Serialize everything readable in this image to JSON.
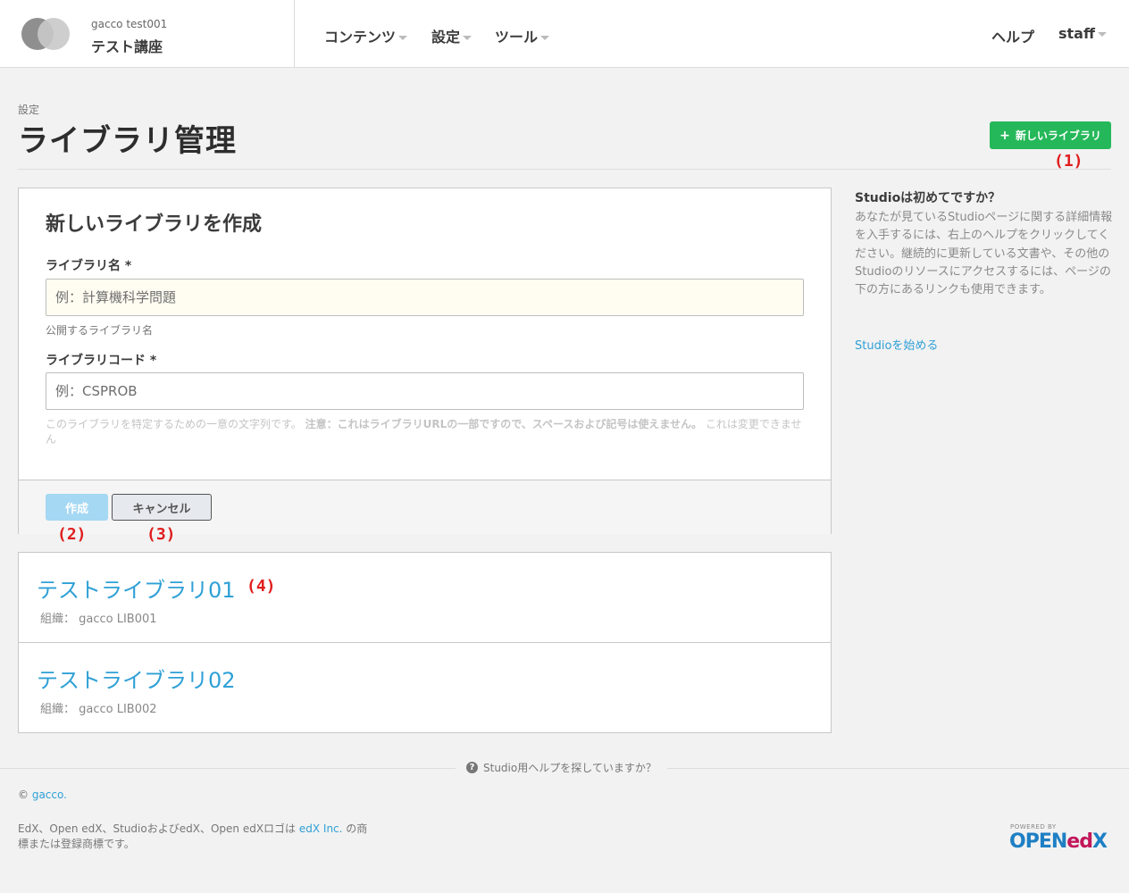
{
  "header": {
    "course_org": "gacco  test001",
    "course_title": "テスト講座",
    "nav": {
      "content": "コンテンツ",
      "settings": "設定",
      "tools": "ツール",
      "help": "ヘルプ",
      "user": "staff"
    }
  },
  "page": {
    "subtitle": "設定",
    "title": "ライブラリ管理",
    "new_library_button": "新しいライブラリ"
  },
  "annotations": {
    "a1": "(1)",
    "a2": "(2)",
    "a3": "(3)",
    "a4": "(4)"
  },
  "form": {
    "heading": "新しいライブラリを作成",
    "name_label": "ライブラリ名 *",
    "name_placeholder": "例：計算機科学問題",
    "name_help": "公開するライブラリ名",
    "code_label": "ライブラリコード *",
    "code_placeholder": "例：CSPROB",
    "code_help_pre": "このライブラリを特定するための一意の文字列です。",
    "code_help_note": "注意：これはライブラリURLの一部ですので、スペースおよび記号は使えません。",
    "code_help_post": "これは変更できません",
    "create_button": "作成",
    "cancel_button": "キャンセル"
  },
  "libraries": [
    {
      "name": "テストライブラリ01",
      "meta": "組織： gacco LIB001"
    },
    {
      "name": "テストライブラリ02",
      "meta": "組織： gacco LIB002"
    }
  ],
  "sidebar": {
    "title": "Studioは初めてですか？",
    "text": "あなたが見ているStudioページに関する詳細情報を入手するには、右上のヘルプをクリックしてください。継続的に更新している文書や、その他のStudioのリソースにアクセスするには、ページの下の方にあるリンクも使用できます。",
    "link": "Studioを始める"
  },
  "footer": {
    "help_find": "Studio用ヘルプを探していますか？",
    "copyright_symbol": "©",
    "copyright_link": "gacco.",
    "legal_pre": "EdX、Open edX、StudioおよびedX、Open edXロゴは",
    "legal_link": "edX Inc.",
    "legal_post": "の商標または登録商標です。",
    "powered_by": "POWERED BY",
    "logo_open": "OPEN",
    "logo_ed": "ed",
    "logo_x": "X"
  },
  "colors": {
    "accent_green": "#25b85a",
    "link_blue": "#2fa0d6",
    "annotation_red": "#e01d1d"
  }
}
